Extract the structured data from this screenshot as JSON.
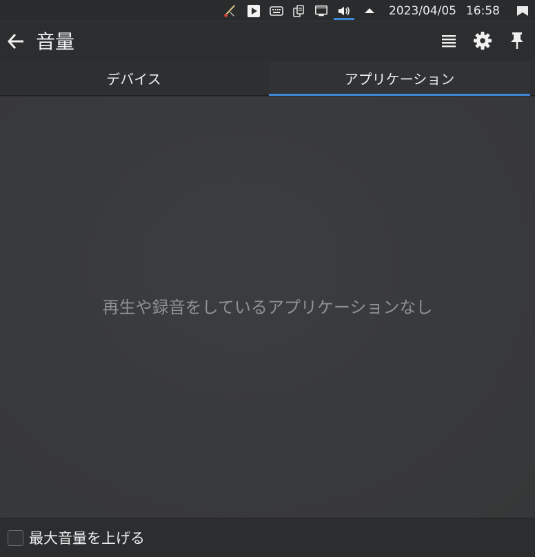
{
  "tray": {
    "icons": [
      "pen-tool-icon",
      "media-player-icon",
      "keyboard-icon",
      "clipboard-icon",
      "network-icon",
      "volume-icon",
      "expand-up-icon",
      "show-desktop-icon"
    ],
    "date": "2023/04/05",
    "time": "16:58",
    "accent_color": "#3d86d8"
  },
  "header": {
    "title": "音量",
    "back_icon": "arrow-left-icon",
    "menu_icon": "hamburger-menu-icon",
    "settings_icon": "gear-icon",
    "pin_icon": "pin-icon"
  },
  "tabs": [
    {
      "label": "デバイス",
      "selected": false
    },
    {
      "label": "アプリケーション",
      "selected": true
    }
  ],
  "main": {
    "empty_message": "再生や録音をしているアプリケーションなし"
  },
  "footer": {
    "checkbox_label": "最大音量を上げる",
    "checkbox_checked": false
  }
}
